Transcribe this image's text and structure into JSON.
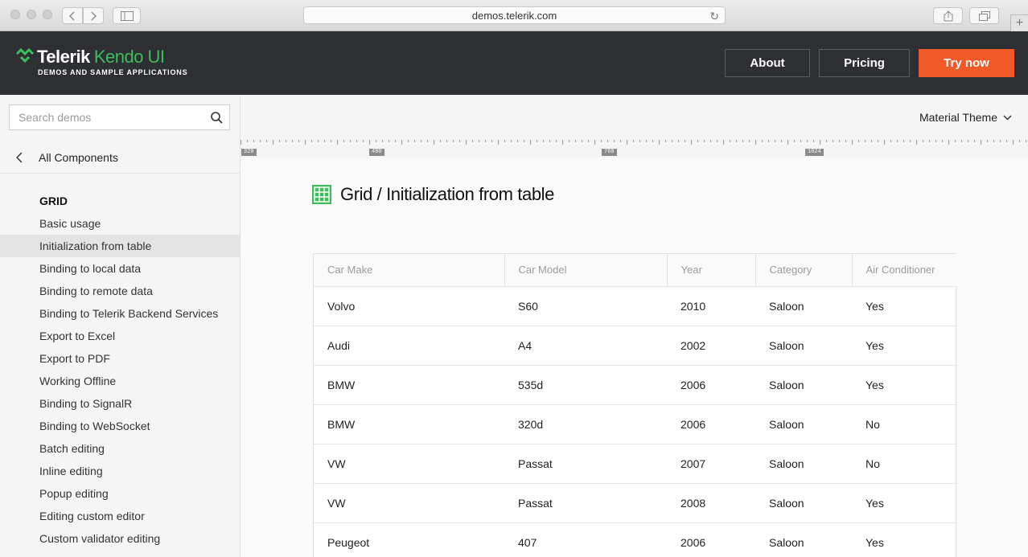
{
  "browser": {
    "url": "demos.telerik.com",
    "new_tab_symbol": "+"
  },
  "header": {
    "brand_primary": "Telerik",
    "brand_secondary": "Kendo UI",
    "brand_tagline": "DEMOS AND SAMPLE APPLICATIONS",
    "about_label": "About",
    "pricing_label": "Pricing",
    "try_label": "Try now",
    "accent_color": "#ef5a28",
    "brand_green": "#3dbd5d"
  },
  "sidebar": {
    "search_placeholder": "Search demos",
    "back_label": "All Components",
    "group_title": "GRID",
    "items": [
      {
        "label": "Basic usage"
      },
      {
        "label": "Initialization from table",
        "active": true
      },
      {
        "label": "Binding to local data"
      },
      {
        "label": "Binding to remote data"
      },
      {
        "label": "Binding to Telerik Backend Services"
      },
      {
        "label": "Export to Excel"
      },
      {
        "label": "Export to PDF"
      },
      {
        "label": "Working Offline"
      },
      {
        "label": "Binding to SignalR"
      },
      {
        "label": "Binding to WebSocket"
      },
      {
        "label": "Batch editing"
      },
      {
        "label": "Inline editing"
      },
      {
        "label": "Popup editing"
      },
      {
        "label": "Editing custom editor"
      },
      {
        "label": "Custom validator editing"
      }
    ]
  },
  "main": {
    "theme_label": "Material Theme",
    "ruler_labels": [
      "320",
      "480",
      "768",
      "1024"
    ],
    "page_title": "Grid / Initialization from table",
    "grid": {
      "columns": [
        "Car Make",
        "Car Model",
        "Year",
        "Category",
        "Air Conditioner"
      ],
      "rows": [
        [
          "Volvo",
          "S60",
          "2010",
          "Saloon",
          "Yes"
        ],
        [
          "Audi",
          "A4",
          "2002",
          "Saloon",
          "Yes"
        ],
        [
          "BMW",
          "535d",
          "2006",
          "Saloon",
          "Yes"
        ],
        [
          "BMW",
          "320d",
          "2006",
          "Saloon",
          "No"
        ],
        [
          "VW",
          "Passat",
          "2007",
          "Saloon",
          "No"
        ],
        [
          "VW",
          "Passat",
          "2008",
          "Saloon",
          "Yes"
        ],
        [
          "Peugeot",
          "407",
          "2006",
          "Saloon",
          "Yes"
        ]
      ]
    }
  }
}
